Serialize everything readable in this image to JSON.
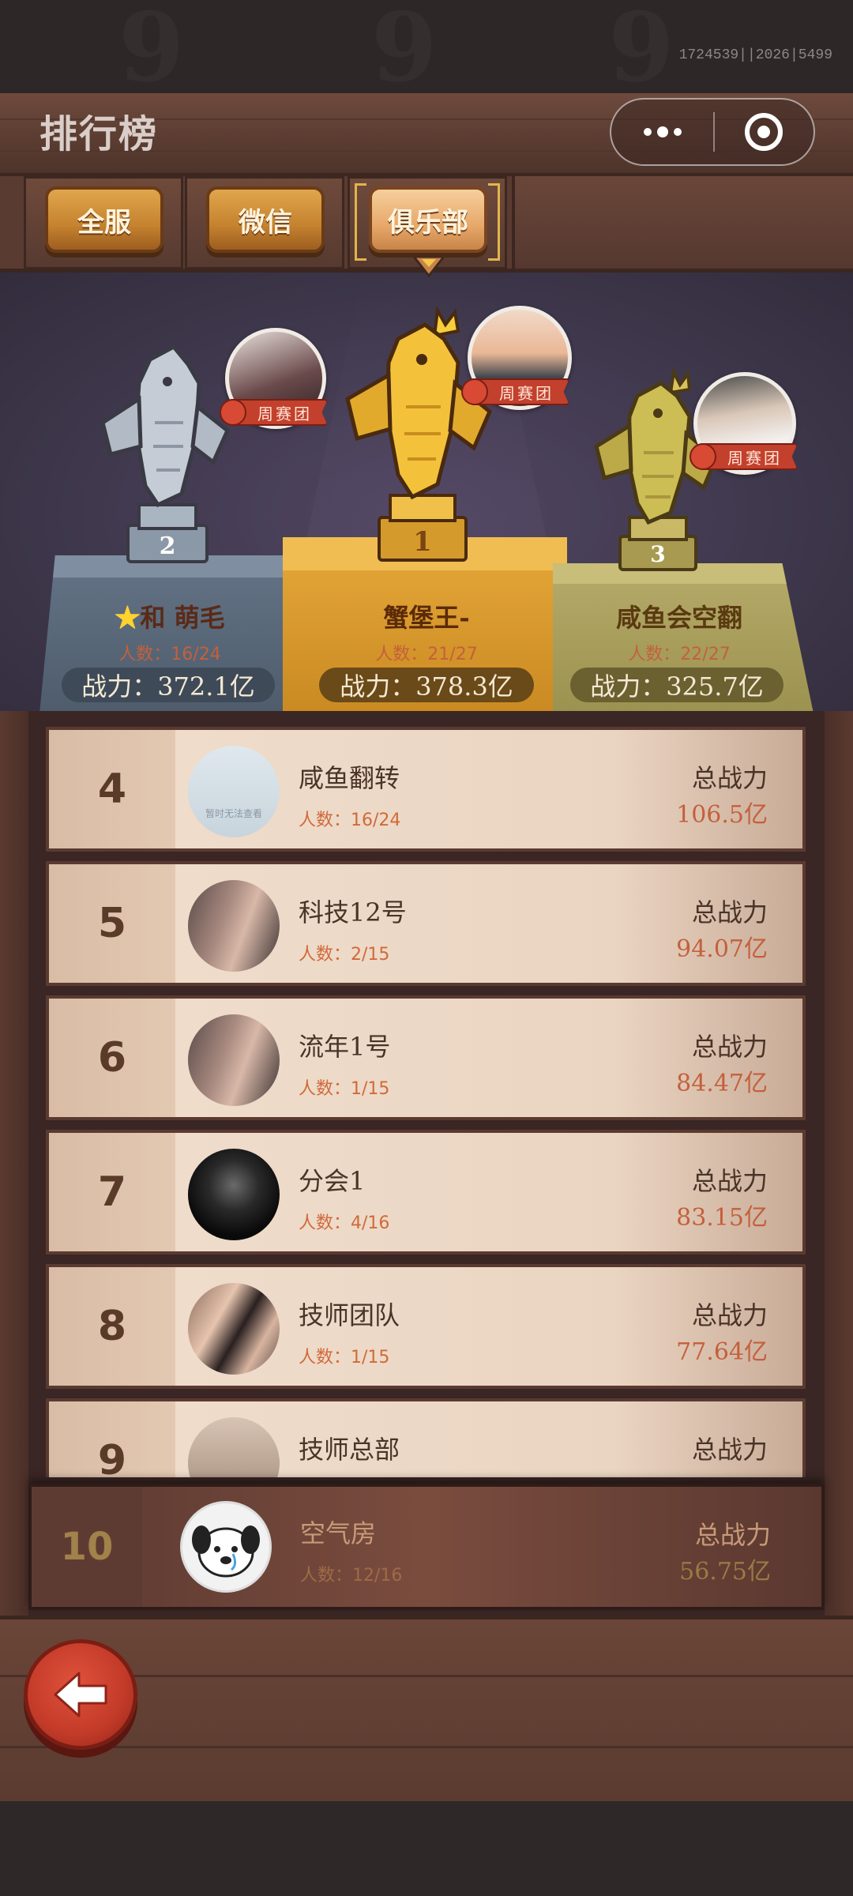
{
  "system": {
    "build_id": "1724539||2026|5499"
  },
  "header": {
    "title": "排行榜"
  },
  "tabs": [
    {
      "label": "全服",
      "active": false
    },
    {
      "label": "微信",
      "active": false
    },
    {
      "label": "俱乐部",
      "active": true
    }
  ],
  "podium": [
    {
      "rank": "1",
      "name": "蟹堡王-",
      "count": "人数：21/27",
      "power": "战力：378.3亿",
      "badge": "周赛团"
    },
    {
      "rank": "2",
      "name": "和 萌毛",
      "count": "人数：16/24",
      "power": "战力：372.1亿",
      "badge": "周赛团"
    },
    {
      "rank": "3",
      "name": "咸鱼会空翻",
      "count": "人数：22/27",
      "power": "战力：325.7亿",
      "badge": "周赛团"
    }
  ],
  "list": [
    {
      "rank": "4",
      "name": "咸鱼翻转",
      "count": "人数：16/24",
      "power_label": "总战力",
      "power": "106.5亿",
      "avatar_text": "暂时无法查看"
    },
    {
      "rank": "5",
      "name": "科技12号",
      "count": "人数：2/15",
      "power_label": "总战力",
      "power": "94.07亿"
    },
    {
      "rank": "6",
      "name": "流年1号",
      "count": "人数：1/15",
      "power_label": "总战力",
      "power": "84.47亿"
    },
    {
      "rank": "7",
      "name": "分会1",
      "count": "人数：4/16",
      "power_label": "总战力",
      "power": "83.15亿"
    },
    {
      "rank": "8",
      "name": "技师团队",
      "count": "人数：1/15",
      "power_label": "总战力",
      "power": "77.64亿"
    },
    {
      "rank": "9",
      "name": "技师总部",
      "count": "",
      "power_label": "总战力",
      "power": ""
    }
  ],
  "self_rank": {
    "rank": "10",
    "name": "空气房",
    "count": "人数：12/16",
    "power_label": "总战力",
    "power": "56.75亿"
  },
  "colors": {
    "gold": "#e7a83a",
    "silver": "#647486",
    "bronze": "#b6ab6a",
    "accent_red": "#c3402c"
  },
  "icons": [
    "more-icon",
    "close-target-icon",
    "back-arrow-icon",
    "fish-trophy-icon"
  ]
}
